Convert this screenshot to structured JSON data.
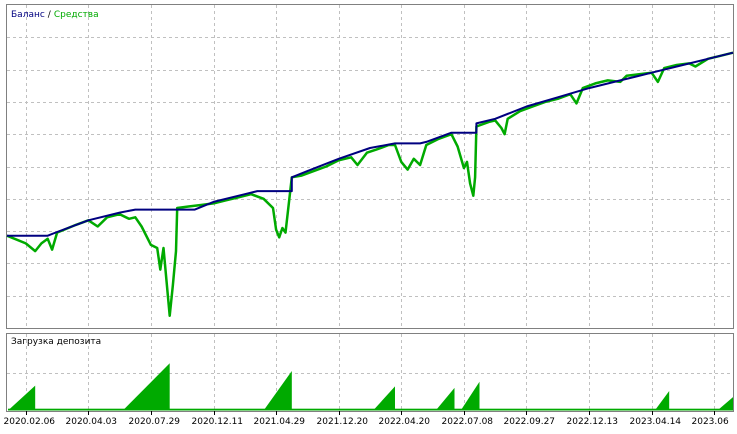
{
  "chart_data": [
    {
      "type": "line",
      "legend": {
        "balance_label": "Баланс",
        "separator": "/",
        "equity_label": "Средства",
        "placement": "top-left"
      },
      "colors": {
        "balance": "#000080",
        "equity": "#00aa00",
        "grid": "#c0c0c0",
        "frame": "#808080"
      },
      "grid": true,
      "x": [
        "2020.02.06",
        "2020.04.03",
        "2020.07.29",
        "2020.12.11",
        "2021.04.29",
        "2021.12.20",
        "2022.04.20",
        "2022.07.08",
        "2022.09.27",
        "2022.12.13",
        "2023.04.14",
        "2023.06"
      ],
      "x_start_offset": -0.3,
      "x_end_offset": 11.3,
      "series": [
        {
          "name": "Баланс",
          "kind": "balance",
          "points": [
            [
              -0.3,
              0.0
            ],
            [
              0.0,
              0.0
            ],
            [
              0.35,
              0.0
            ],
            [
              0.5,
              0.12
            ],
            [
              1.0,
              0.5
            ],
            [
              1.5,
              0.75
            ],
            [
              1.75,
              0.85
            ],
            [
              2.0,
              0.85
            ],
            [
              2.7,
              0.85
            ],
            [
              3.0,
              1.1
            ],
            [
              3.5,
              1.35
            ],
            [
              3.7,
              1.45
            ],
            [
              4.0,
              1.45
            ],
            [
              4.25,
              1.45
            ],
            [
              4.25,
              1.9
            ],
            [
              4.5,
              2.1
            ],
            [
              5.0,
              2.5
            ],
            [
              5.5,
              2.85
            ],
            [
              5.9,
              3.0
            ],
            [
              6.3,
              3.0
            ],
            [
              6.4,
              3.05
            ],
            [
              6.8,
              3.35
            ],
            [
              7.2,
              3.35
            ],
            [
              7.2,
              3.65
            ],
            [
              7.5,
              3.8
            ],
            [
              8.0,
              4.2
            ],
            [
              8.5,
              4.5
            ],
            [
              9.0,
              4.8
            ],
            [
              9.5,
              5.05
            ],
            [
              10.0,
              5.3
            ],
            [
              10.5,
              5.55
            ],
            [
              11.0,
              5.8
            ],
            [
              11.3,
              5.95
            ]
          ]
        },
        {
          "name": "Средства",
          "kind": "equity",
          "points": [
            [
              -0.3,
              0.0
            ],
            [
              0.0,
              -0.25
            ],
            [
              0.15,
              -0.5
            ],
            [
              0.25,
              -0.25
            ],
            [
              0.35,
              -0.1
            ],
            [
              0.42,
              -0.45
            ],
            [
              0.5,
              0.1
            ],
            [
              0.8,
              0.35
            ],
            [
              1.0,
              0.5
            ],
            [
              1.15,
              0.3
            ],
            [
              1.3,
              0.6
            ],
            [
              1.5,
              0.7
            ],
            [
              1.65,
              0.55
            ],
            [
              1.75,
              0.6
            ],
            [
              1.85,
              0.3
            ],
            [
              2.0,
              -0.3
            ],
            [
              2.1,
              -0.4
            ],
            [
              2.15,
              -1.1
            ],
            [
              2.2,
              -0.4
            ],
            [
              2.25,
              -1.5
            ],
            [
              2.3,
              -2.6
            ],
            [
              2.35,
              -1.6
            ],
            [
              2.4,
              -0.5
            ],
            [
              2.42,
              0.9
            ],
            [
              2.6,
              0.95
            ],
            [
              2.8,
              1.0
            ],
            [
              3.0,
              1.05
            ],
            [
              3.2,
              1.15
            ],
            [
              3.4,
              1.25
            ],
            [
              3.6,
              1.35
            ],
            [
              3.8,
              1.2
            ],
            [
              3.95,
              0.9
            ],
            [
              4.0,
              0.2
            ],
            [
              4.05,
              -0.05
            ],
            [
              4.1,
              0.25
            ],
            [
              4.15,
              0.1
            ],
            [
              4.25,
              1.9
            ],
            [
              4.4,
              1.95
            ],
            [
              4.6,
              2.1
            ],
            [
              4.8,
              2.25
            ],
            [
              5.0,
              2.45
            ],
            [
              5.2,
              2.55
            ],
            [
              5.3,
              2.3
            ],
            [
              5.45,
              2.7
            ],
            [
              5.6,
              2.8
            ],
            [
              5.8,
              2.95
            ],
            [
              5.9,
              2.95
            ],
            [
              6.0,
              2.4
            ],
            [
              6.1,
              2.15
            ],
            [
              6.2,
              2.5
            ],
            [
              6.3,
              2.3
            ],
            [
              6.4,
              2.95
            ],
            [
              6.6,
              3.15
            ],
            [
              6.8,
              3.3
            ],
            [
              6.9,
              2.9
            ],
            [
              7.0,
              2.2
            ],
            [
              7.05,
              2.4
            ],
            [
              7.1,
              1.7
            ],
            [
              7.15,
              1.3
            ],
            [
              7.18,
              1.9
            ],
            [
              7.2,
              3.55
            ],
            [
              7.4,
              3.7
            ],
            [
              7.5,
              3.75
            ],
            [
              7.6,
              3.5
            ],
            [
              7.65,
              3.3
            ],
            [
              7.7,
              3.8
            ],
            [
              7.9,
              4.05
            ],
            [
              8.1,
              4.2
            ],
            [
              8.3,
              4.35
            ],
            [
              8.5,
              4.45
            ],
            [
              8.7,
              4.6
            ],
            [
              8.8,
              4.3
            ],
            [
              8.9,
              4.8
            ],
            [
              9.1,
              4.95
            ],
            [
              9.3,
              5.05
            ],
            [
              9.5,
              5.0
            ],
            [
              9.6,
              5.2
            ],
            [
              9.8,
              5.25
            ],
            [
              10.0,
              5.3
            ],
            [
              10.1,
              5.0
            ],
            [
              10.2,
              5.45
            ],
            [
              10.4,
              5.55
            ],
            [
              10.6,
              5.6
            ],
            [
              10.7,
              5.5
            ],
            [
              10.9,
              5.75
            ],
            [
              11.1,
              5.85
            ],
            [
              11.3,
              5.95
            ]
          ]
        }
      ],
      "ylim": [
        -3.0,
        7.5
      ]
    },
    {
      "type": "area",
      "title": "Загрузка депозита",
      "colors": {
        "fill": "#00aa00"
      },
      "grid": true,
      "peaks": [
        {
          "x0": -0.3,
          "x1": 0.15,
          "v": 0.33
        },
        {
          "x0": 1.55,
          "x1": 2.3,
          "v": 0.62
        },
        {
          "x0": 3.8,
          "x1": 4.25,
          "v": 0.52
        },
        {
          "x0": 5.55,
          "x1": 5.9,
          "v": 0.32
        },
        {
          "x0": 6.55,
          "x1": 6.85,
          "v": 0.3
        },
        {
          "x0": 6.95,
          "x1": 7.25,
          "v": 0.38
        },
        {
          "x0": 10.05,
          "x1": 10.28,
          "v": 0.26
        },
        {
          "x0": 11.05,
          "x1": 11.3,
          "v": 0.18
        }
      ],
      "baseline": 0.03,
      "ylim": [
        0,
        1
      ]
    }
  ]
}
